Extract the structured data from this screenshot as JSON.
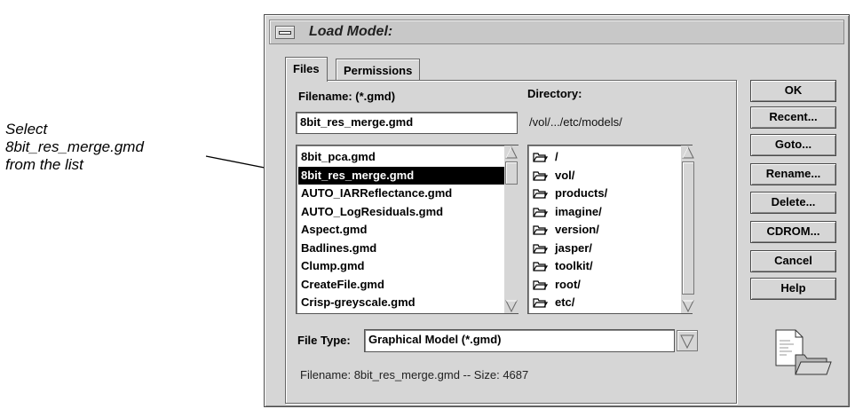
{
  "annotation": {
    "lines": [
      "Select",
      "8bit_res_merge.gmd",
      "from the list"
    ]
  },
  "window": {
    "title": "Load Model:"
  },
  "tabs": [
    {
      "label": "Files",
      "active": true
    },
    {
      "label": "Permissions",
      "active": false
    }
  ],
  "filename": {
    "label": "Filename: (*.gmd)",
    "value": "8bit_res_merge.gmd"
  },
  "directory": {
    "label": "Directory:",
    "path": "/vol/.../etc/models/"
  },
  "file_list": [
    {
      "name": "8bit_pca.gmd",
      "selected": false
    },
    {
      "name": "8bit_res_merge.gmd",
      "selected": true
    },
    {
      "name": "AUTO_IARReflectance.gmd",
      "selected": false
    },
    {
      "name": "AUTO_LogResiduals.gmd",
      "selected": false
    },
    {
      "name": "Aspect.gmd",
      "selected": false
    },
    {
      "name": "Badlines.gmd",
      "selected": false
    },
    {
      "name": "Clump.gmd",
      "selected": false
    },
    {
      "name": "CreateFile.gmd",
      "selected": false
    },
    {
      "name": "Crisp-greyscale.gmd",
      "selected": false
    }
  ],
  "dir_list": [
    "/",
    "vol/",
    "products/",
    "imagine/",
    "version/",
    "jasper/",
    "toolkit/",
    "root/",
    "etc/"
  ],
  "file_type": {
    "label": "File Type:",
    "value": "Graphical Model (*.gmd)"
  },
  "status": "Filename: 8bit_res_merge.gmd -- Size: 4687",
  "buttons": {
    "ok": "OK",
    "recent": "Recent...",
    "goto": "Goto...",
    "rename": "Rename...",
    "delete": "Delete...",
    "cdrom": "CDROM...",
    "cancel": "Cancel",
    "help": "Help"
  },
  "icons": {
    "folder": "folder-open-icon",
    "document": "document-folder-icon"
  }
}
